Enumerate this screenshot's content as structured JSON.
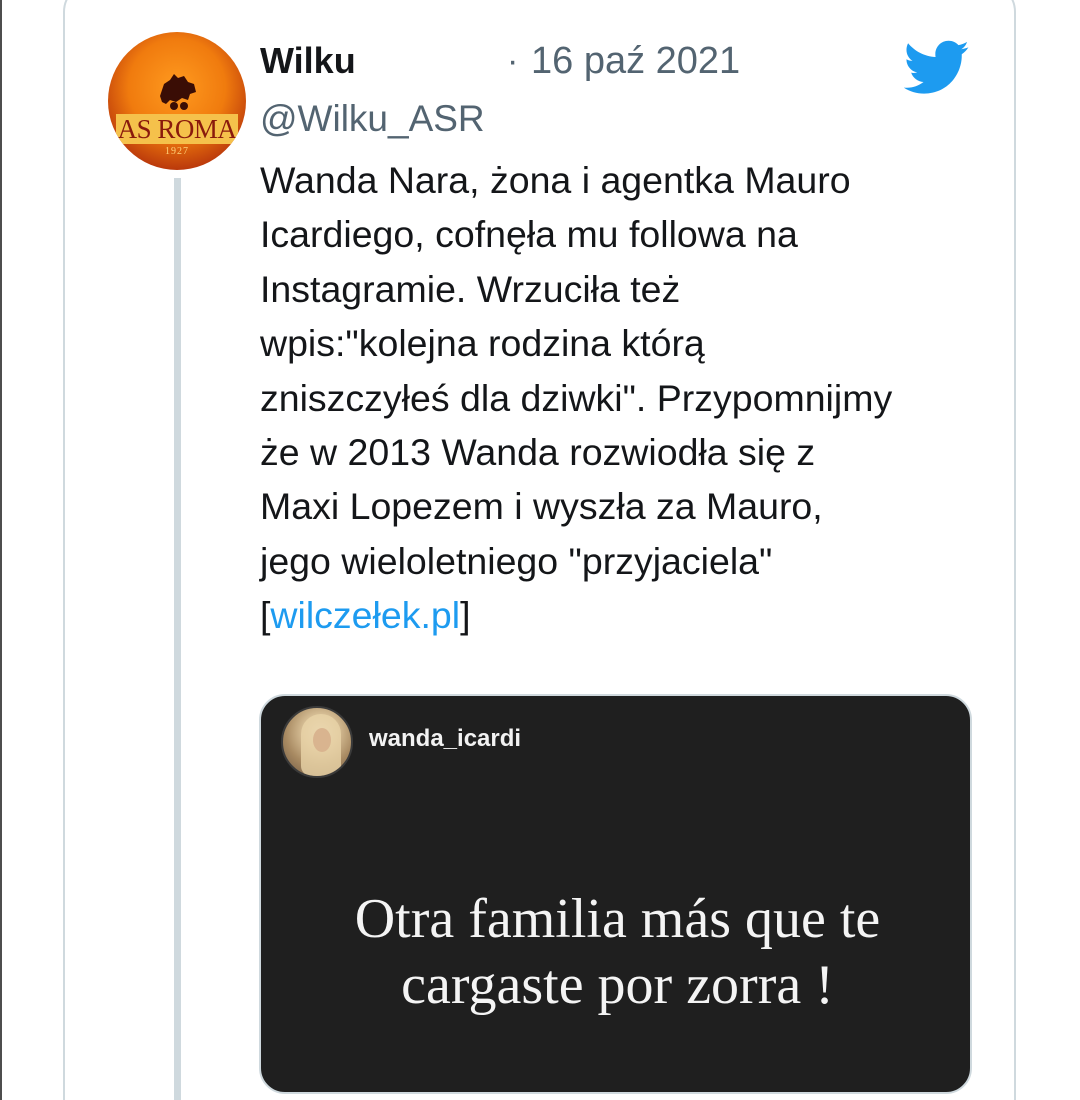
{
  "tweet": {
    "author_name": "Wilku",
    "separator": "·",
    "date": "16 paź 2021",
    "handle": "@Wilku_ASR",
    "avatar": {
      "text": "AS ROMA",
      "year": "1927",
      "colors": {
        "primary": "#f07b0e",
        "secondary": "#8a1a0c",
        "accent": "#f5c14b"
      }
    },
    "body_lines": [
      "Wanda Nara, żona i agentka Mauro",
      "Icardiego, cofnęła mu followa na",
      "Instagramie. Wrzuciła też",
      "wpis:\"kolejna rodzina którą",
      "zniszczyłeś dla dziwki\". Przypomnijmy",
      "że w 2013 Wanda rozwiodła się z",
      "Maxi Lopezem i wyszła za Mauro,",
      "jego wieloletniego \"przyjaciela\""
    ],
    "link_prefix": "[",
    "link_text": "wilczełek.pl",
    "link_suffix": "]",
    "icon": "twitter-bird-icon",
    "colors": {
      "brand": "#1d9bf0",
      "text": "#141619",
      "muted": "#536471",
      "border": "#cfd9de"
    }
  },
  "embed": {
    "username": "wanda_icardi",
    "story_lines": [
      "Otra familia más que te",
      "cargaste por zorra !"
    ],
    "background": "#1f1f1f"
  }
}
